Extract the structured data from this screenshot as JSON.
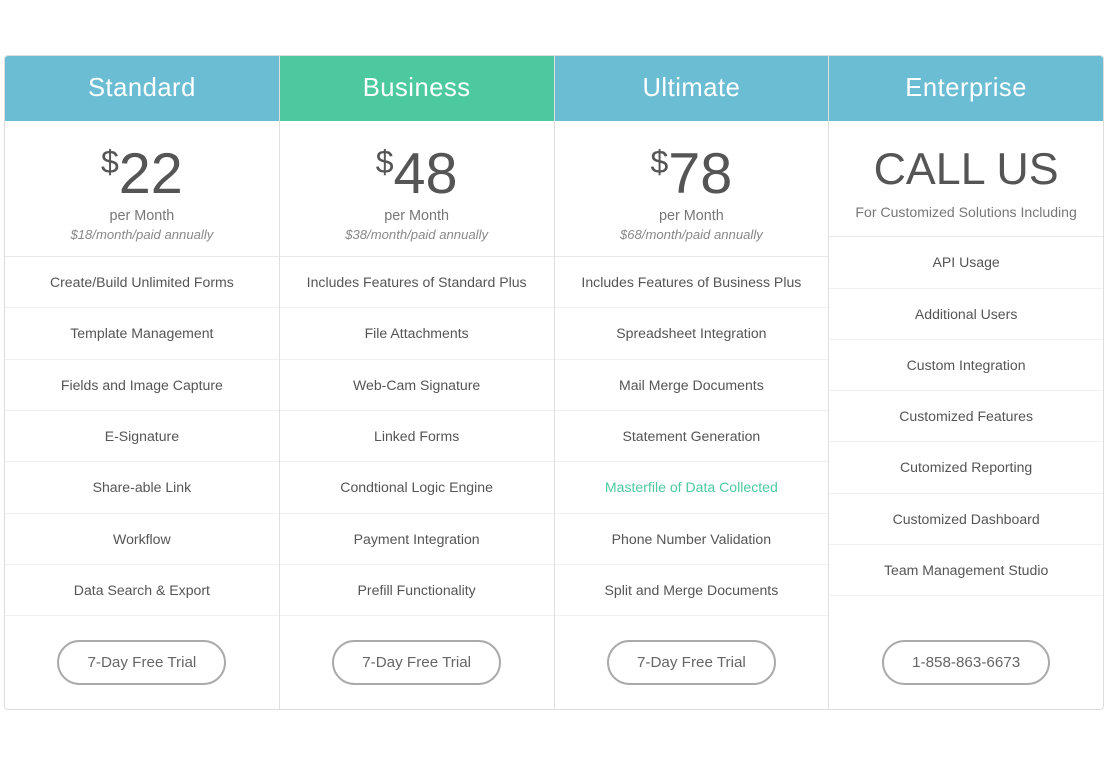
{
  "plans": [
    {
      "id": "standard",
      "header_class": "standard",
      "name": "Standard",
      "price": "22",
      "price_type": "number",
      "per_month": "per Month",
      "annual": "$18/month/paid annually",
      "features": [
        {
          "text": "Create/Build Unlimited Forms",
          "highlight": false
        },
        {
          "text": "Template Management",
          "highlight": false
        },
        {
          "text": "Fields and Image Capture",
          "highlight": false
        },
        {
          "text": "E-Signature",
          "highlight": false
        },
        {
          "text": "Share-able Link",
          "highlight": false
        },
        {
          "text": "Workflow",
          "highlight": false
        },
        {
          "text": "Data  Search & Export",
          "highlight": false
        }
      ],
      "cta_label": "7-Day Free Trial"
    },
    {
      "id": "business",
      "header_class": "business",
      "name": "Business",
      "price": "48",
      "price_type": "number",
      "per_month": "per Month",
      "annual": "$38/month/paid annually",
      "features": [
        {
          "text": "Includes Features of Standard Plus",
          "highlight": false
        },
        {
          "text": "File Attachments",
          "highlight": false
        },
        {
          "text": "Web-Cam Signature",
          "highlight": false
        },
        {
          "text": "Linked Forms",
          "highlight": false
        },
        {
          "text": "Condtional Logic Engine",
          "highlight": false
        },
        {
          "text": "Payment Integration",
          "highlight": false
        },
        {
          "text": "Prefill Functionality",
          "highlight": false
        }
      ],
      "cta_label": "7-Day Free Trial"
    },
    {
      "id": "ultimate",
      "header_class": "ultimate",
      "name": "Ultimate",
      "price": "78",
      "price_type": "number",
      "per_month": "per Month",
      "annual": "$68/month/paid annually",
      "features": [
        {
          "text": "Includes Features of Business Plus",
          "highlight": false
        },
        {
          "text": "Spreadsheet Integration",
          "highlight": false
        },
        {
          "text": "Mail Merge Documents",
          "highlight": false
        },
        {
          "text": "Statement Generation",
          "highlight": false
        },
        {
          "text": "Masterfile of Data Collected",
          "highlight": true
        },
        {
          "text": "Phone Number Validation",
          "highlight": false
        },
        {
          "text": "Split and Merge Documents",
          "highlight": false
        }
      ],
      "cta_label": "7-Day Free Trial"
    },
    {
      "id": "enterprise",
      "header_class": "enterprise",
      "name": "Enterprise",
      "price": "CALL US",
      "price_type": "text",
      "for_customized": "For Customized Solutions Including",
      "features": [
        {
          "text": "API Usage",
          "highlight": false
        },
        {
          "text": "Additional Users",
          "highlight": false
        },
        {
          "text": "Custom Integration",
          "highlight": false
        },
        {
          "text": "Customized Features",
          "highlight": false
        },
        {
          "text": "Cutomized Reporting",
          "highlight": false
        },
        {
          "text": "Customized Dashboard",
          "highlight": false
        },
        {
          "text": "Team Management Studio",
          "highlight": false
        }
      ],
      "cta_label": "1-858-863-6673"
    }
  ]
}
